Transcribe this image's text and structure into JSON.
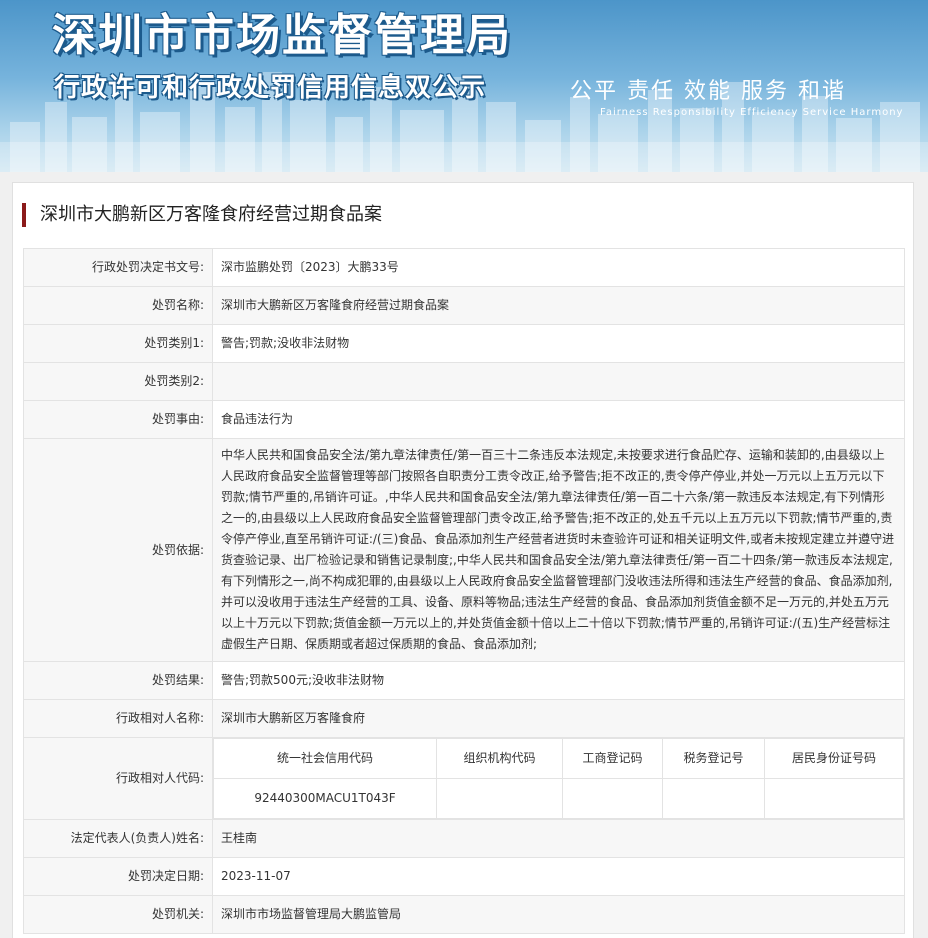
{
  "banner": {
    "title": "深圳市市场监督管理局",
    "subtitle": "行政许可和行政处罚信用信息双公示",
    "slogan": "公平 责任 效能 服务 和谐",
    "slogan_en": "Fairness Responsibility Efficiency Service Harmony"
  },
  "page_title": "深圳市大鹏新区万客隆食府经营过期食品案",
  "fields": {
    "doc_no": {
      "label": "行政处罚决定书文号:",
      "value": "深市监鹏处罚〔2023〕大鹏33号"
    },
    "case_name": {
      "label": "处罚名称:",
      "value": "深圳市大鹏新区万客隆食府经营过期食品案"
    },
    "type1": {
      "label": "处罚类别1:",
      "value": "警告;罚款;没收非法财物"
    },
    "type2": {
      "label": "处罚类别2:",
      "value": ""
    },
    "reason": {
      "label": "处罚事由:",
      "value": "食品违法行为"
    },
    "basis": {
      "label": "处罚依据:",
      "value": "中华人民共和国食品安全法/第九章法律责任/第一百三十二条违反本法规定,未按要求进行食品贮存、运输和装卸的,由县级以上人民政府食品安全监督管理等部门按照各自职责分工责令改正,给予警告;拒不改正的,责令停产停业,并处一万元以上五万元以下罚款;情节严重的,吊销许可证。,中华人民共和国食品安全法/第九章法律责任/第一百二十六条/第一款违反本法规定,有下列情形之一的,由县级以上人民政府食品安全监督管理部门责令改正,给予警告;拒不改正的,处五千元以上五万元以下罚款;情节严重的,责令停产停业,直至吊销许可证:/(三)食品、食品添加剂生产经营者进货时未查验许可证和相关证明文件,或者未按规定建立并遵守进货查验记录、出厂检验记录和销售记录制度;,中华人民共和国食品安全法/第九章法律责任/第一百二十四条/第一款违反本法规定,有下列情形之一,尚不构成犯罪的,由县级以上人民政府食品安全监督管理部门没收违法所得和违法生产经营的食品、食品添加剂,并可以没收用于违法生产经营的工具、设备、原料等物品;违法生产经营的食品、食品添加剂货值金额不足一万元的,并处五万元以上十万元以下罚款;货值金额一万元以上的,并处货值金额十倍以上二十倍以下罚款;情节严重的,吊销许可证:/(五)生产经营标注虚假生产日期、保质期或者超过保质期的食品、食品添加剂;"
    },
    "result": {
      "label": "处罚结果:",
      "value": "警告;罚款500元;没收非法财物"
    },
    "party_name": {
      "label": "行政相对人名称:",
      "value": "深圳市大鹏新区万客隆食府"
    },
    "party_code": {
      "label": "行政相对人代码:",
      "headers": [
        "统一社会信用代码",
        "组织机构代码",
        "工商登记码",
        "税务登记号",
        "居民身份证号码"
      ],
      "values": [
        "92440300MACU1T043F",
        "",
        "",
        "",
        ""
      ]
    },
    "legal_rep": {
      "label": "法定代表人(负责人)姓名:",
      "value": "王桂南"
    },
    "decision_date": {
      "label": "处罚决定日期:",
      "value": "2023-11-07"
    },
    "authority": {
      "label": "处罚机关:",
      "value": "深圳市市场监督管理局大鹏监管局"
    }
  }
}
